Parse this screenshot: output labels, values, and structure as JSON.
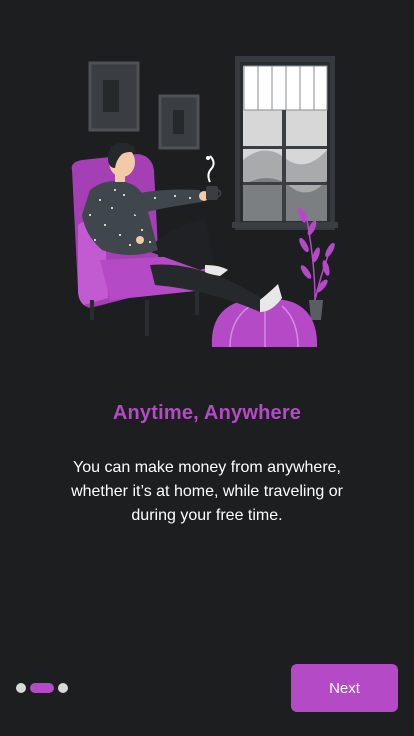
{
  "colors": {
    "background": "#1c1e20",
    "accent": "#b44ac6",
    "dot_inactive": "#d9d9d9",
    "text": "#ffffff"
  },
  "illustration": {
    "icon": "man-relaxing-in-armchair-illustration"
  },
  "onboarding": {
    "title": "Anytime, Anywhere",
    "description": "You can make money from anywhere, whether it’s at home, while traveling or during your free time."
  },
  "pager": {
    "total_pages": 3,
    "current_page": 2
  },
  "next_button": {
    "label": "Next"
  }
}
